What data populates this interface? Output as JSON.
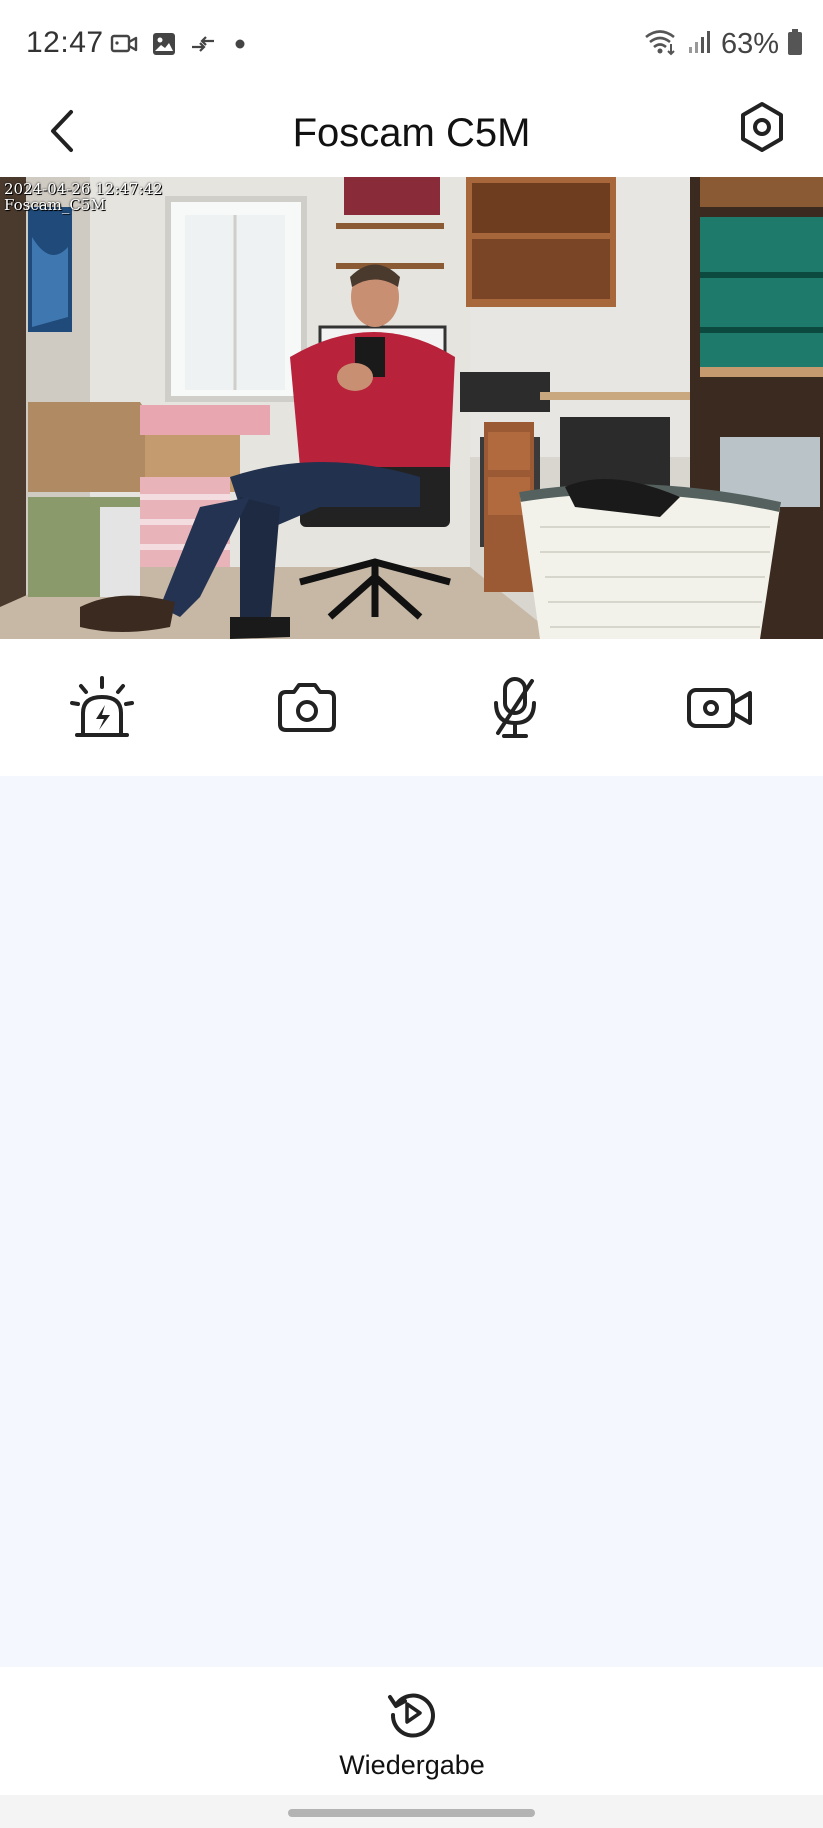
{
  "status_bar": {
    "time": "12:47",
    "battery": "63%",
    "icons_left": [
      "video-recording-icon",
      "gallery-icon",
      "data-sync-icon",
      "dot-icon"
    ],
    "icons_right": [
      "wifi-icon",
      "signal-icon",
      "battery-icon"
    ]
  },
  "header": {
    "title": "Foscam C5M",
    "back_icon": "chevron-left-icon",
    "settings_icon": "settings-hexagon-icon"
  },
  "video": {
    "timestamp": "2024-04-26 12:47:42",
    "camera_name": "Foscam_C5M"
  },
  "controls": [
    {
      "name": "siren-button",
      "icon": "siren-icon"
    },
    {
      "name": "snapshot-button",
      "icon": "camera-icon"
    },
    {
      "name": "microphone-button",
      "icon": "microphone-muted-icon"
    },
    {
      "name": "record-button",
      "icon": "video-camera-icon"
    }
  ],
  "bottom_bar": {
    "playback_label": "Wiedergabe",
    "playback_icon": "replay-icon"
  },
  "colors": {
    "content_background": "#f4f7fd",
    "icon": "#222222"
  }
}
